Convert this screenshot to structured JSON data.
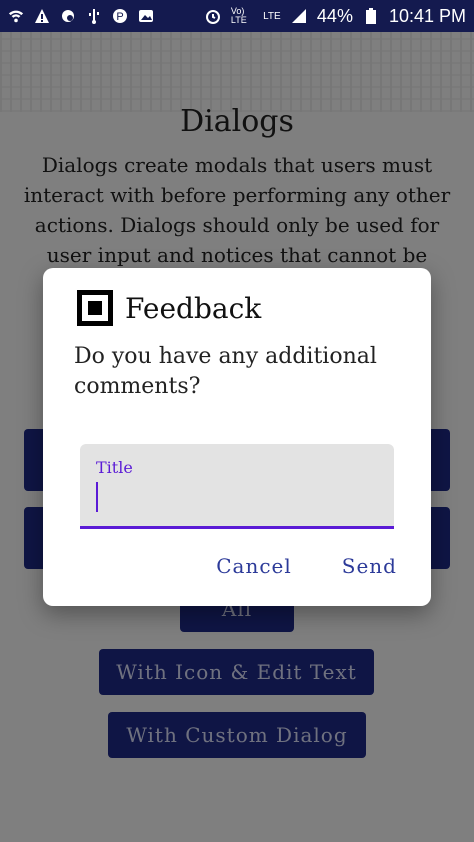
{
  "status_bar": {
    "battery_percent": "44%",
    "time": "10:41 PM",
    "left_icons": [
      "wifi-icon",
      "warning-icon",
      "weather-icon",
      "usb-icon",
      "pinterest-icon",
      "image-icon"
    ],
    "right_icons": [
      "alarm-icon",
      "volte-icon",
      "lte-icon",
      "signal-icon",
      "battery-icon"
    ],
    "volte_label": "Vo) LTE",
    "lte_label": "LTE"
  },
  "page": {
    "title": "Dialogs",
    "description": "Dialogs create modals that users must interact with before performing any other actions. Dialogs should only be used for user input and notices that cannot be delayed.",
    "buttons": [
      {
        "label": ""
      },
      {
        "label": ""
      },
      {
        "label": ""
      },
      {
        "label": ""
      },
      {
        "label": "All"
      },
      {
        "label": "With Icon & Edit Text"
      },
      {
        "label": "With Custom Dialog"
      }
    ]
  },
  "dialog": {
    "title": "Feedback",
    "message": "Do you have any additional comments?",
    "field_label": "Title",
    "field_value": "",
    "cancel_label": "Cancel",
    "send_label": "Send"
  },
  "colors": {
    "status_bar": "#141a4f",
    "primary_button": "#1f2a8a",
    "accent": "#5b1bd6",
    "action_text": "#2c3a99"
  }
}
